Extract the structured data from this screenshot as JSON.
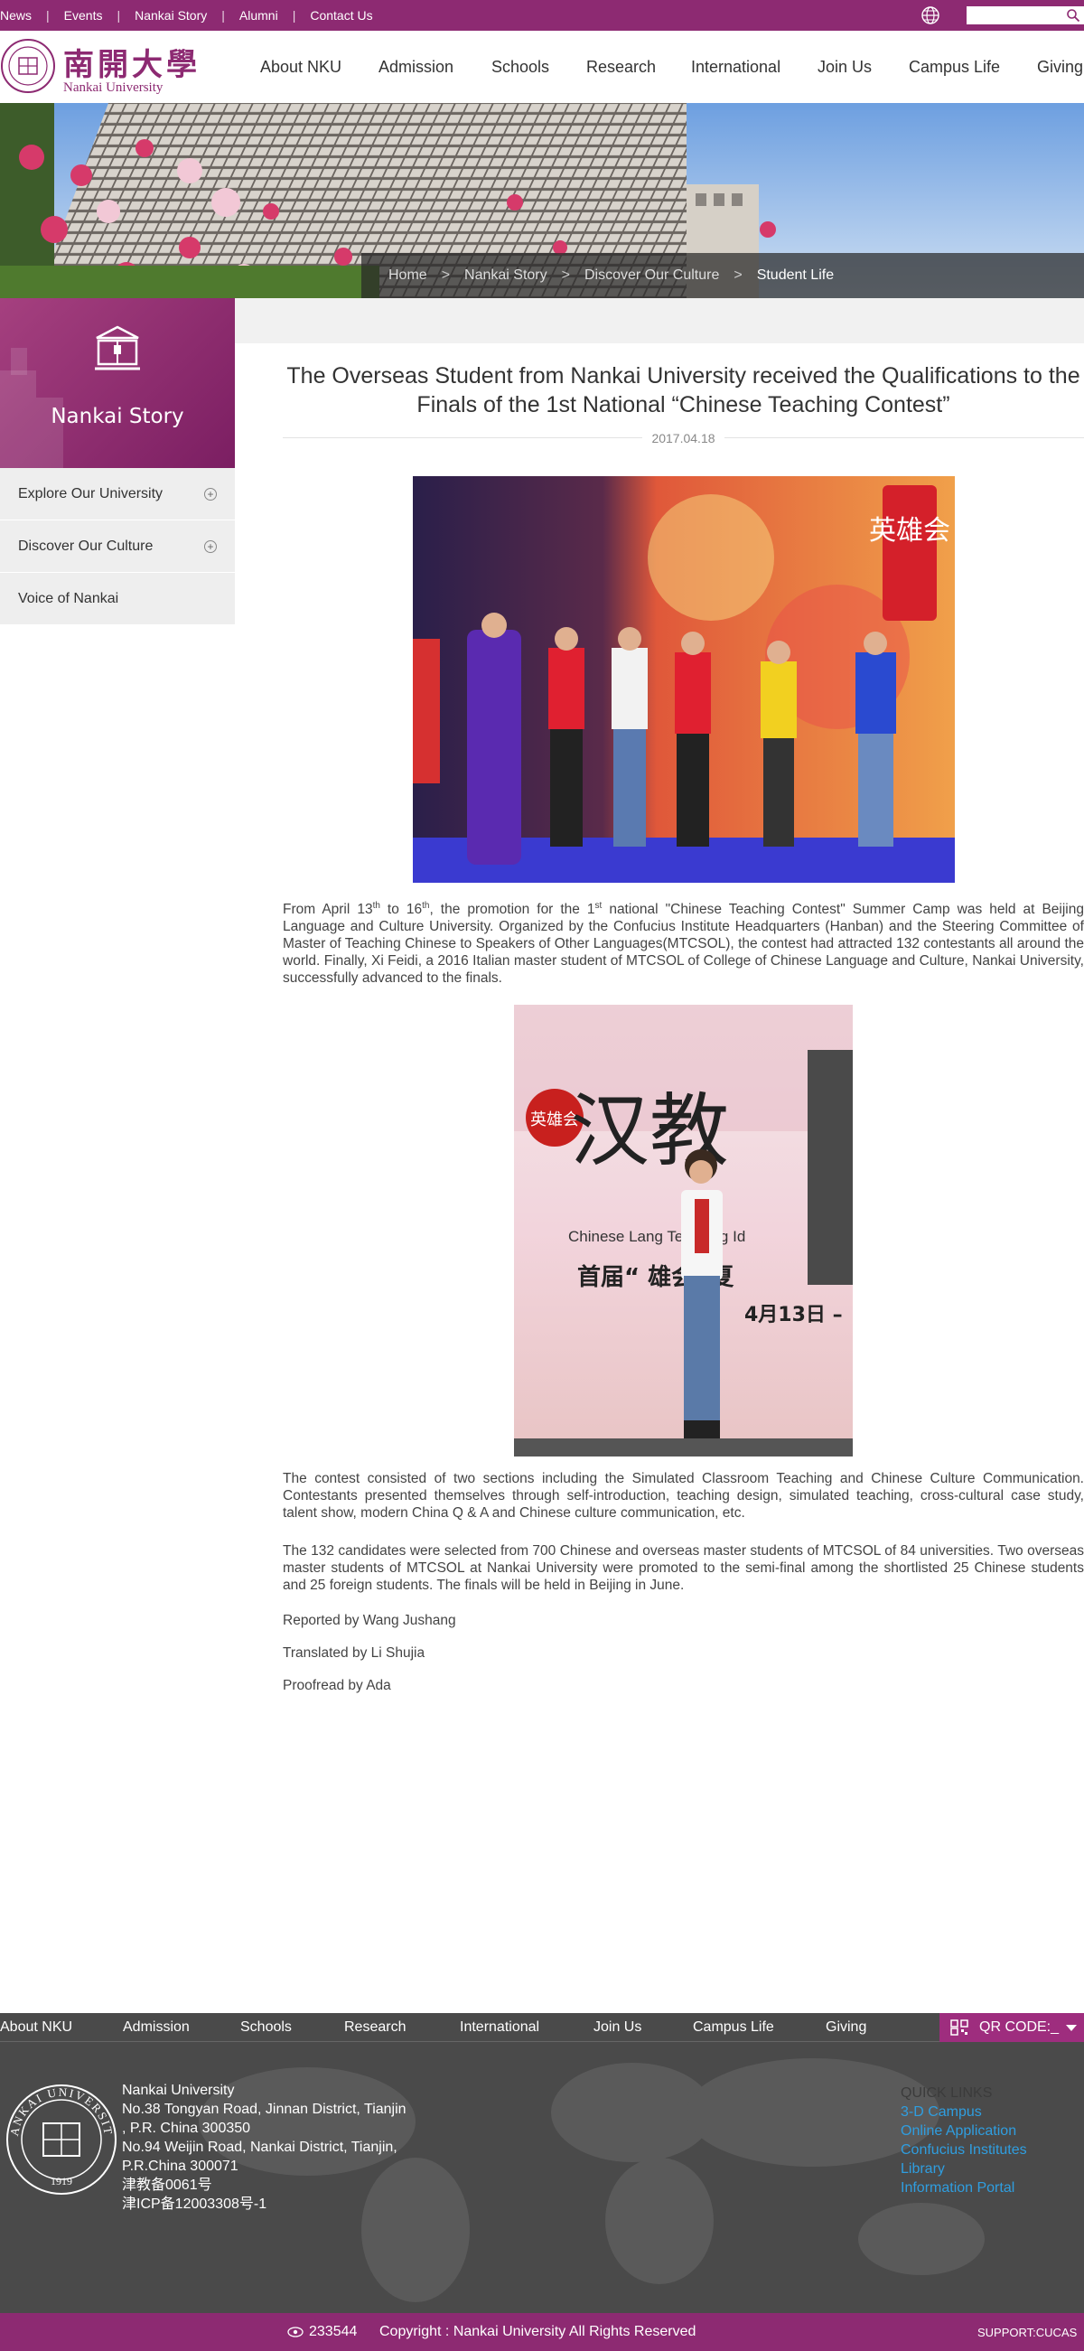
{
  "topbar": {
    "links": [
      "News",
      "Events",
      "Nankai Story",
      "Alumni",
      "Contact Us"
    ]
  },
  "header": {
    "logo_cn": "南開大學",
    "logo_en": "Nankai University",
    "nav": [
      "About NKU",
      "Admission",
      "Schools",
      "Research",
      "International",
      "Join Us",
      "Campus Life",
      "Giving"
    ]
  },
  "breadcrumb": {
    "items": [
      "Home",
      "Nankai Story",
      "Discover Our Culture",
      "Student Life"
    ],
    "separator": ">"
  },
  "sidebar": {
    "title": "Nankai Story",
    "items": [
      {
        "label": "Explore Our University",
        "expandable": true
      },
      {
        "label": "Discover Our Culture",
        "expandable": true
      },
      {
        "label": "Voice of Nankai",
        "expandable": false
      }
    ]
  },
  "article": {
    "title": "The Overseas Student from Nankai University received the Qualifications to the Finals of the 1st National “Chinese Teaching Contest”",
    "date": "2017.04.18",
    "p1": {
      "a": "From April 13",
      "sup1": "th",
      "b": " to 16",
      "sup2": "th",
      "c": ", the promotion for the 1",
      "sup3": "st",
      "d": " national \"Chinese Teaching Contest\" Summer Camp was held at Beijing Language and Culture University. Organized by the Confucius Institute Headquarters (Hanban) and the Steering Committee of Master of Teaching Chinese to Speakers of Other Languages(MTCSOL), the contest had attracted 132 contestants all around the world. Finally, Xi Feidi, a 2016 Italian master student of MTCSOL of College of Chinese Language and Culture, Nankai University, successfully advanced to the finals."
    },
    "p2": "The contest consisted of two sections including the Simulated Classroom Teaching and Chinese Culture Communication. Contestants presented themselves through self-introduction, teaching design, simulated teaching, cross-cultural case study, talent show, modern China Q & A and Chinese culture communication, etc.",
    "p3": "The 132 candidates were selected from 700 Chinese and overseas master students of MTCSOL of 84 universities. Two overseas master students of MTCSOL at Nankai University were promoted to the semi-final among the shortlisted 25 Chinese students and 25 foreign students. The finals will be held in Beijing in June.",
    "reported": "Reported by Wang Jushang",
    "translated": "Translated by Li Shujia",
    "proofread": "Proofread by Ada",
    "poster_text": {
      "hero": "英雄会",
      "big": "汉教",
      "en": "Chinese Lang Teaching Id",
      "cn_line": "首届“  雄会”夏",
      "date": "4月13日 –"
    },
    "stage_sign": "英雄会"
  },
  "footer": {
    "nav": [
      "About NKU",
      "Admission",
      "Schools",
      "Research",
      "International",
      "Join Us",
      "Campus Life",
      "Giving"
    ],
    "qr_label": "QR CODE:_",
    "address": [
      "Nankai University",
      "No.38 Tongyan Road, Jinnan District, Tianjin",
      ", P.R. China 300350",
      "No.94 Weijin Road,  Nankai District, Tianjin,",
      "P.R.China  300071",
      "津教备0061号",
      "津ICP备12003308号-1"
    ],
    "quick_links_title": "QUICK LINKS",
    "quick_links": [
      "3-D Campus",
      "Online Application",
      "Confucius Institutes",
      "Library",
      "Information Portal"
    ],
    "visits": "233544",
    "copyright": "Copyright : Nankai University All Rights Reserved",
    "support": "SUPPORT:CUCAS",
    "seal_text": "NANKAI UNIVERSITY",
    "seal_year": "1919"
  },
  "colors": {
    "brand": "#8d2a72",
    "footer_bg": "#4a4a4a",
    "link_blue": "#2f9ee0"
  }
}
